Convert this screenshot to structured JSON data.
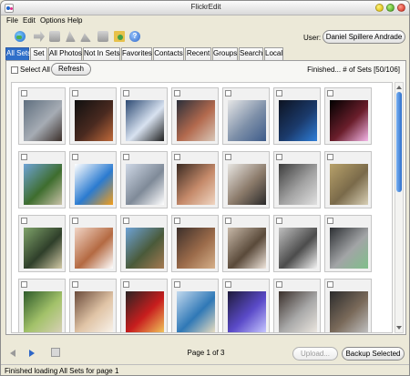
{
  "window": {
    "title": "FlickrEdit"
  },
  "menu": [
    "File",
    "Edit",
    "Options",
    "Help"
  ],
  "toolbar": {
    "icons": [
      "globe-icon",
      "send-icon",
      "stop-icon",
      "sort-icon",
      "sort-alt-icon",
      "photo-icon",
      "folder-icon",
      "help-icon"
    ],
    "help_glyph": "?",
    "user_label": "User:",
    "user_name": "Daniel Spillere Andrade"
  },
  "tabs": [
    {
      "label": "All Sets",
      "active": true
    },
    {
      "label": "Set",
      "active": false
    },
    {
      "label": "All Photos",
      "active": false
    },
    {
      "label": "Not In Sets",
      "active": false
    },
    {
      "label": "Favorites",
      "active": false
    },
    {
      "label": "Contacts",
      "active": false
    },
    {
      "label": "Recent",
      "active": false
    },
    {
      "label": "Groups",
      "active": false
    },
    {
      "label": "Search",
      "active": false
    },
    {
      "label": "Local",
      "active": false
    }
  ],
  "controls": {
    "select_all_label": "Select All",
    "refresh_label": "Refresh",
    "status_top": "Finished... # of Sets [50/106]"
  },
  "thumbnails": [
    {
      "colors": [
        "#5f6f7f",
        "#a6acb4",
        "#3b2f2a"
      ]
    },
    {
      "colors": [
        "#101010",
        "#4a2a20",
        "#c06a3a"
      ]
    },
    {
      "colors": [
        "#2d4a73",
        "#d8e2f0",
        "#1f1f1f"
      ]
    },
    {
      "colors": [
        "#2a2f3a",
        "#b36a4e",
        "#d9c7b8"
      ]
    },
    {
      "colors": [
        "#e6e6e6",
        "#7d8fa8",
        "#3d5b8a"
      ]
    },
    {
      "colors": [
        "#0d1321",
        "#1b3a6b",
        "#2f7fd9"
      ]
    },
    {
      "colors": [
        "#000000",
        "#6a1e2b",
        "#f4b6e8"
      ]
    },
    {
      "colors": [
        "#6ea3d6",
        "#3e6d2e",
        "#c9c2a8"
      ]
    },
    {
      "colors": [
        "#ffffff",
        "#2b7bd0",
        "#f29d1a"
      ]
    },
    {
      "colors": [
        "#cfd8e6",
        "#7f8a98",
        "#ffffff"
      ]
    },
    {
      "colors": [
        "#3a2a22",
        "#c58a6a",
        "#f0d6c2"
      ]
    },
    {
      "colors": [
        "#e8e6e2",
        "#8b7a6a",
        "#2a2a2a"
      ]
    },
    {
      "colors": [
        "#3c3c3c",
        "#a3a3a3",
        "#e0e0e0"
      ]
    },
    {
      "colors": [
        "#b7a16a",
        "#7a6a4a",
        "#d8cfb5"
      ]
    },
    {
      "colors": [
        "#7fa36a",
        "#2f3f2a",
        "#d2c9a6"
      ]
    },
    {
      "colors": [
        "#f1d5c6",
        "#b46a42",
        "#ffffff"
      ]
    },
    {
      "colors": [
        "#6ea3d6",
        "#4a5a3a",
        "#a57a52"
      ]
    },
    {
      "colors": [
        "#3c2f2a",
        "#9b6b4a",
        "#d6b08a"
      ]
    },
    {
      "colors": [
        "#c7b8a8",
        "#5a4a3a",
        "#f0e6dc"
      ]
    },
    {
      "colors": [
        "#bfbfbf",
        "#4c4c4c",
        "#f4f4f4"
      ]
    },
    {
      "colors": [
        "#2c2f33",
        "#a2a4a6",
        "#7fbf8a"
      ]
    },
    {
      "colors": [
        "#2d5a2a",
        "#a3c26a",
        "#d7d0b5"
      ]
    },
    {
      "colors": [
        "#6a4a3a",
        "#e0c4a6",
        "#f8f2ea"
      ]
    },
    {
      "colors": [
        "#2a2323",
        "#c81e1e",
        "#f0c35a"
      ]
    },
    {
      "colors": [
        "#c2d9ee",
        "#2f78b6",
        "#e7dcc0"
      ]
    },
    {
      "colors": [
        "#1e1a3a",
        "#5b4bc9",
        "#c6c6ff"
      ]
    },
    {
      "colors": [
        "#3a2f2a",
        "#a9a9a9",
        "#ebe6df"
      ]
    },
    {
      "colors": [
        "#2c2c2c",
        "#7a6a5a",
        "#bfbfbf"
      ]
    }
  ],
  "bottom": {
    "page_label": "Page 1 of 3",
    "upload_label": "Upload...",
    "backup_label": "Backup Selected"
  },
  "statusbar": {
    "text": "Finished loading All Sets for page 1"
  }
}
